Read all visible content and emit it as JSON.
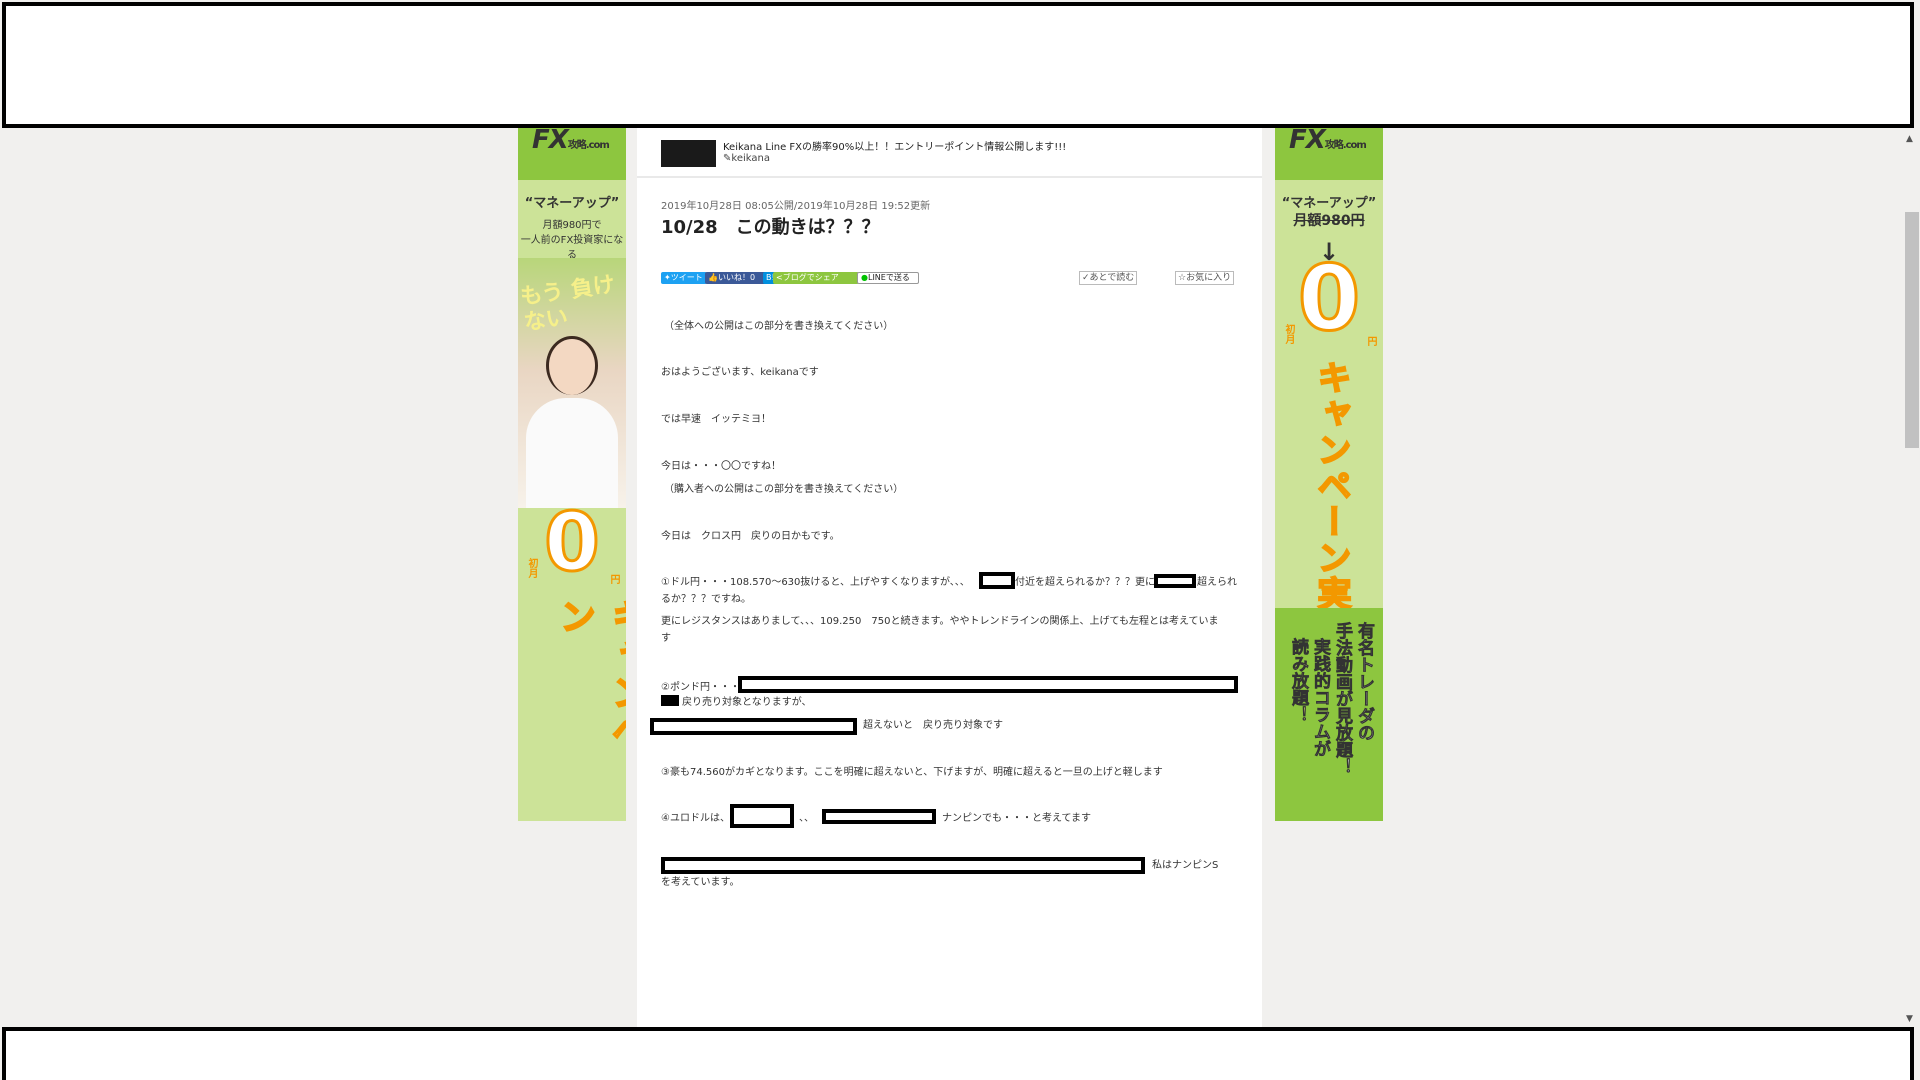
{
  "banner_left": {
    "logo": "FX",
    "logo_sub": "攻略.com",
    "title": "“マネーアップ”",
    "sub1": "月額980円で",
    "sub2": "一人前のFX投資家になる",
    "catch": "もう 負けない",
    "zero": "0",
    "yen": "円",
    "first": "初月",
    "campaign": "キャンペーン"
  },
  "banner_right": {
    "logo": "FX",
    "logo_sub": "攻略.com",
    "title": "“マネーアップ”",
    "price": "月額980円",
    "arrow": "↓",
    "zero": "0",
    "yen": "円",
    "first": "初月",
    "campaign": "キャンペーン実施中",
    "green1": "有名トレーダの",
    "green2": "手法動画が見放題！",
    "green3": "実践的コラムが",
    "green4": "読み放題！"
  },
  "article": {
    "blog_title": "Keikana Line FXの勝率90%以上！！エントリーポイント情報公開します!!!",
    "author": "keikana",
    "dates": "2019年10月28日 08:05公開/2019年10月28日 19:52更新",
    "title": "10/28　この動きは？？？",
    "share": {
      "tweet": "ツイート",
      "like": "いいね！0",
      "hatena": "B!",
      "blogshare": "ブログでシェア",
      "line": "LINEで送る",
      "later": "あとで読む",
      "fav": "お気に入り"
    },
    "paragraphs": {
      "p1": "（全体への公開はこの部分を書き換えてください）",
      "p2": "おはようございます、keikanaです",
      "p3": "では早速　イッテミヨ！",
      "p4": "今日は・・・〇〇ですね！",
      "p5": "（購入者への公開はこの部分を書き換えてください）",
      "p6": "今日は　クロス円　戻りの日かもです。",
      "p7a": "①ドル円・・・108.570〜630抜けると、上げやすくなりますが、、、",
      "p7b": "付近を超えられるか？？？更に",
      "p7c": "超えられ",
      "p7d": "るか？？？ですね。",
      "p8": "更にレジスタンスはありまして、、、109.250　750と続きます。ややトレンドラインの関係上、上げても左程とは考えていま",
      "p8b": "す",
      "p9a": "②ポンド円・・・",
      "p9b": "戻り売り対象となりますが、",
      "p9c": "超えないと　戻り売り対象です",
      "p10": "③豪も74.560がカギとなります。ここを明確に超えないと、下げますが、明確に超えると一旦の上げと軽します",
      "p11a": "④ユロドルは、",
      "p11b": "、、",
      "p11c": "ナンピンでも・・・と考えてます",
      "p12a": "私はナンピンS",
      "p12b": "を考えています。"
    }
  }
}
